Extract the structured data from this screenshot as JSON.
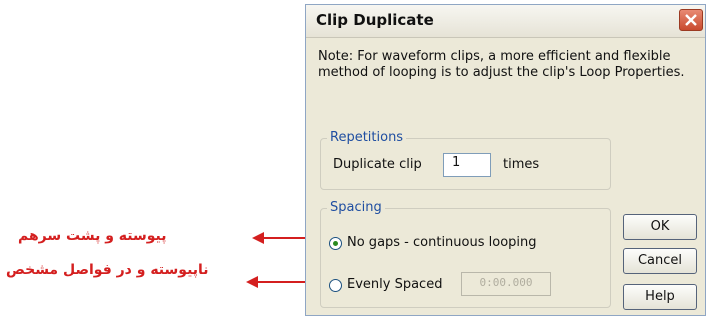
{
  "dialog": {
    "title": "Clip Duplicate",
    "note": "Note:  For waveform clips, a more efficient and flexible method of looping is to adjust the clip's Loop Properties.",
    "repetitions": {
      "group_label": "Repetitions",
      "duplicate_label": "Duplicate clip",
      "count_value": "1",
      "times_label": "times"
    },
    "spacing": {
      "group_label": "Spacing",
      "no_gaps_label": "No gaps - continuous looping",
      "no_gaps_selected": true,
      "evenly_spaced_label": "Evenly Spaced",
      "evenly_spaced_value": "0:00.000"
    },
    "buttons": {
      "ok": "OK",
      "cancel": "Cancel",
      "help": "Help"
    }
  },
  "annotations": {
    "no_gaps_note": "پیوسته و پشت سرهم",
    "evenly_spaced_note": "ناپیوسته و در فواصل مشخص"
  },
  "colors": {
    "annotation_red": "#d41f1f",
    "group_title_blue": "#1f4ea1",
    "dialog_bg": "#ece9d8",
    "close_button": "#c94a2e"
  }
}
